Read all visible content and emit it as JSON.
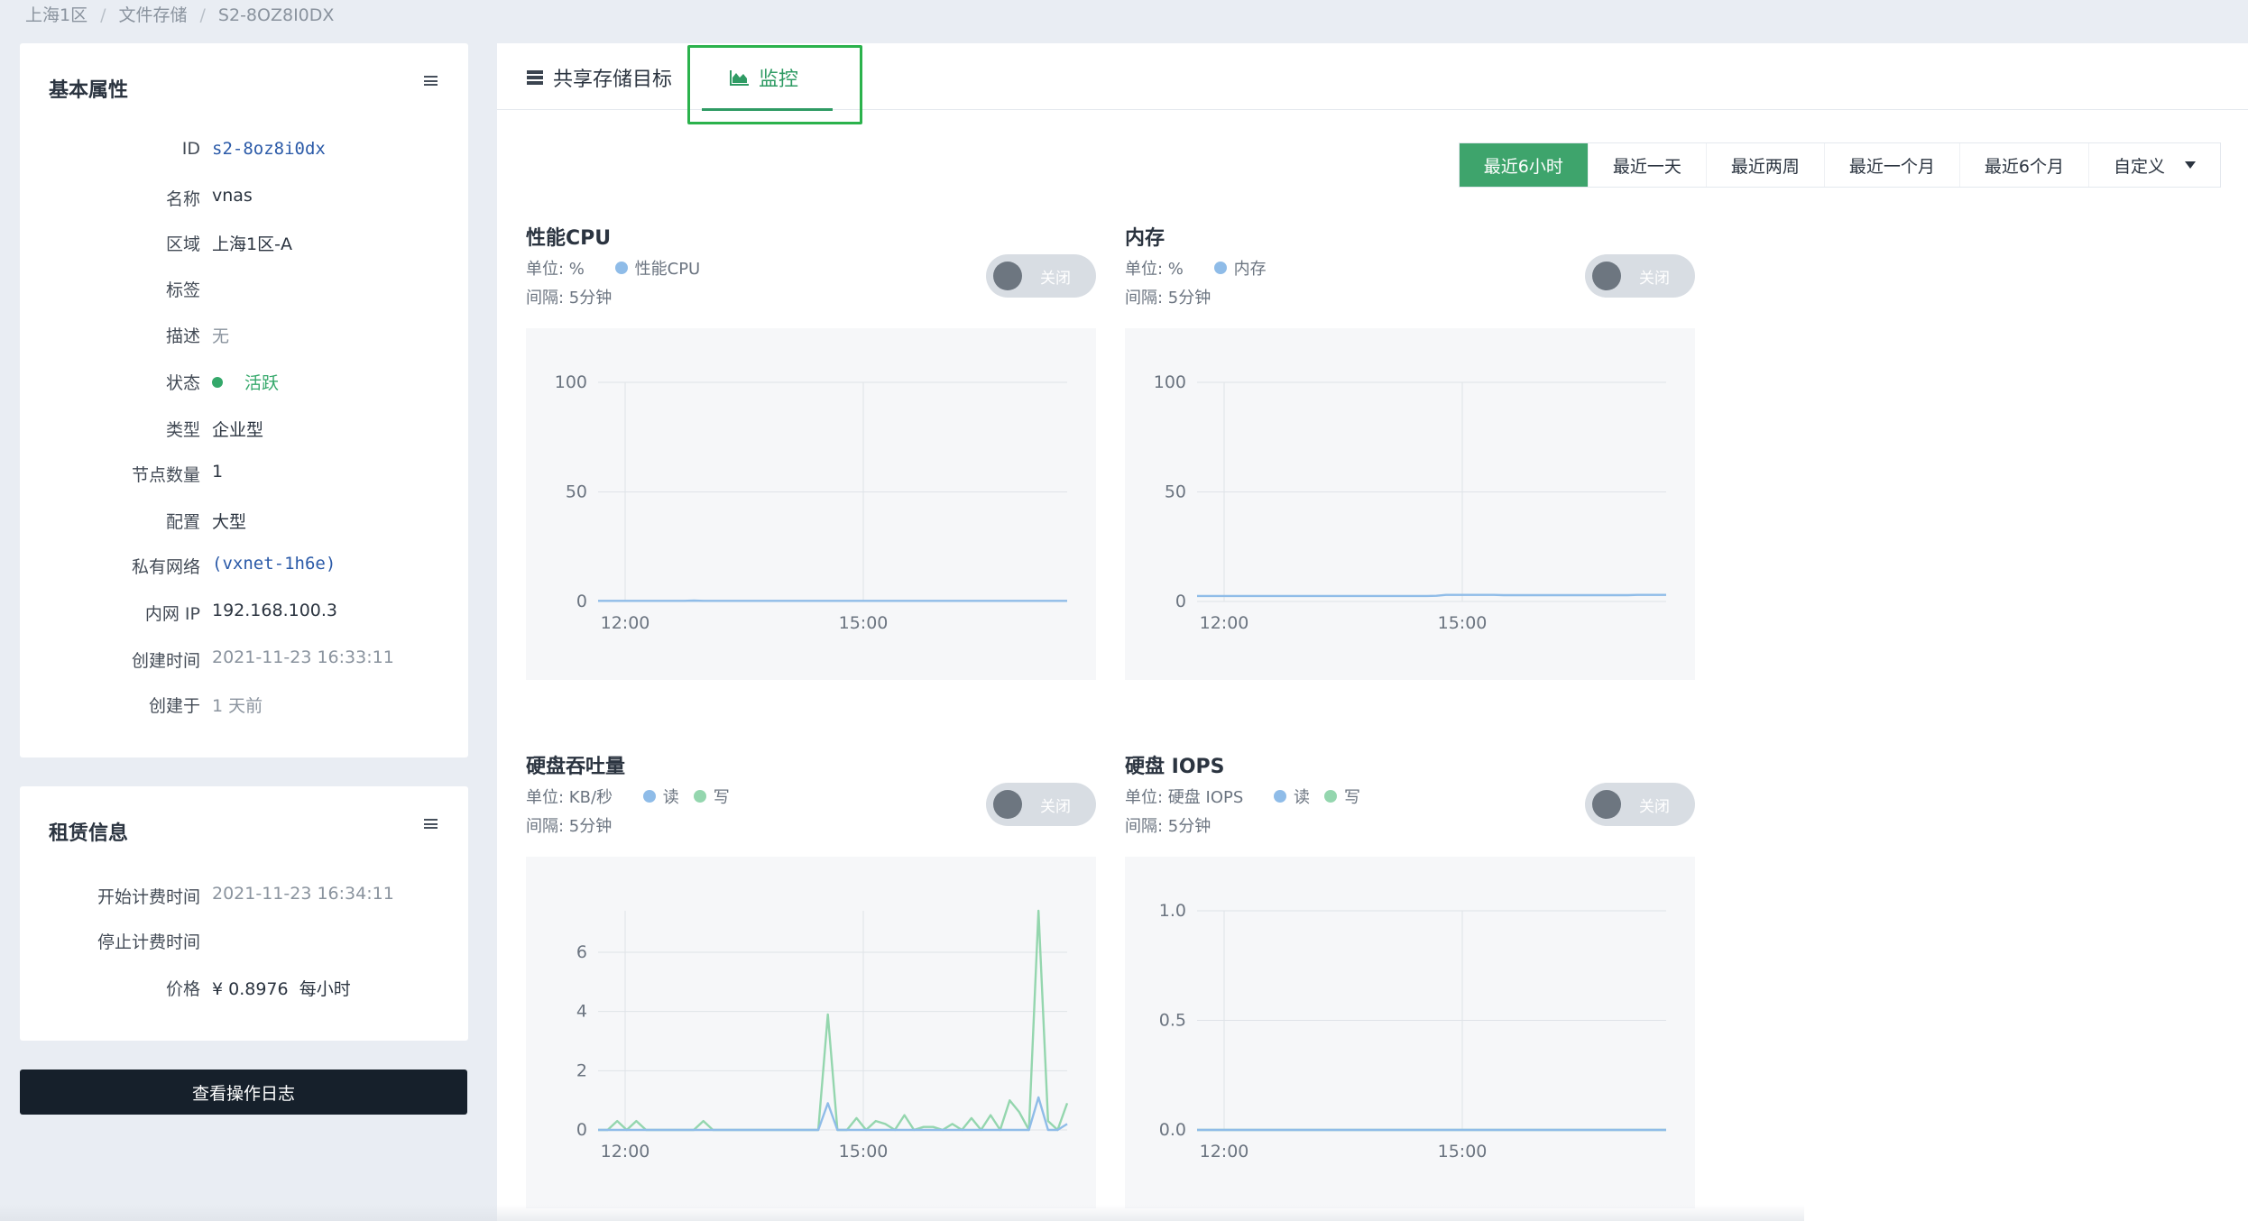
{
  "breadcrumb": [
    "上海1区",
    "文件存储",
    "S2-8OZ8I0DX"
  ],
  "basic_props": {
    "title": "基本属性",
    "rows": [
      {
        "label": "ID",
        "value": "s2-8oz8i0dx"
      },
      {
        "label": "名称",
        "value": "vnas"
      },
      {
        "label": "区域",
        "value": "上海1区-A"
      },
      {
        "label": "标签",
        "value": ""
      },
      {
        "label": "描述",
        "value": "无"
      },
      {
        "label": "状态",
        "value": "活跃"
      },
      {
        "label": "类型",
        "value": "企业型"
      },
      {
        "label": "节点数量",
        "value": "1"
      },
      {
        "label": "配置",
        "value": "大型"
      },
      {
        "label": "私有网络",
        "value": "(vxnet-1h6e)"
      },
      {
        "label": "内网 IP",
        "value": "192.168.100.3"
      },
      {
        "label": "创建时间",
        "value": "2021-11-23 16:33:11"
      },
      {
        "label": "创建于",
        "value": "1 天前"
      }
    ]
  },
  "lease": {
    "title": "租赁信息",
    "rows": [
      {
        "label": "开始计费时间",
        "value": "2021-11-23 16:34:11"
      },
      {
        "label": "停止计费时间",
        "value": ""
      },
      {
        "label": "价格",
        "value": "¥ 0.8976  每小时"
      }
    ]
  },
  "log_button": "查看操作日志",
  "tabs": [
    {
      "label": "共享存储目标",
      "icon": "storage-icon",
      "active": false
    },
    {
      "label": "监控",
      "icon": "area-chart-icon",
      "active": true
    }
  ],
  "time_ranges": [
    "最近6小时",
    "最近一天",
    "最近两周",
    "最近一个月",
    "最近6个月",
    "自定义"
  ],
  "active_range": "最近6小时",
  "colors": {
    "accent": "#3ea46c",
    "read": "#8fbce8",
    "write": "#94d6ae",
    "highlight": "#2bb24c"
  },
  "charts": [
    {
      "title": "性能CPU",
      "unit": "单位: %",
      "interval": "间隔: 5分钟",
      "toggle_label": "关闭",
      "legend": [
        {
          "name": "性能CPU",
          "color": "#8fbce8"
        }
      ],
      "chart_data": {
        "type": "line",
        "ylim": [
          0,
          100
        ],
        "yticks": [
          "0",
          "50",
          "100"
        ],
        "xticks": [
          "12:00",
          "15:00"
        ],
        "series": [
          {
            "name": "性能CPU",
            "color": "#8fbce8",
            "values": [
              0.3,
              0.3,
              0.3,
              0.3,
              0.3,
              0.3,
              0.3,
              0.3,
              0.3,
              0.3,
              0.4,
              0.3,
              0.3,
              0.3,
              0.3,
              0.3,
              0.3,
              0.3,
              0.3,
              0.3,
              0.3,
              0.3,
              0.3,
              0.3,
              0.3,
              0.3,
              0.3,
              0.3,
              0.3,
              0.3,
              0.3,
              0.3,
              0.3,
              0.3,
              0.3,
              0.3,
              0.3,
              0.3,
              0.3,
              0.3,
              0.3,
              0.3,
              0.3,
              0.3,
              0.3,
              0.3,
              0.3,
              0.3,
              0.3,
              0.3
            ]
          }
        ]
      }
    },
    {
      "title": "内存",
      "unit": "单位: %",
      "interval": "间隔: 5分钟",
      "toggle_label": "关闭",
      "legend": [
        {
          "name": "内存",
          "color": "#8fbce8"
        }
      ],
      "chart_data": {
        "type": "line",
        "ylim": [
          0,
          100
        ],
        "yticks": [
          "0",
          "50",
          "100"
        ],
        "xticks": [
          "12:00",
          "15:00"
        ],
        "series": [
          {
            "name": "内存",
            "color": "#8fbce8",
            "values": [
              2.5,
              2.5,
              2.5,
              2.5,
              2.5,
              2.5,
              2.5,
              2.5,
              2.5,
              2.5,
              2.5,
              2.5,
              2.5,
              2.5,
              2.5,
              2.5,
              2.5,
              2.5,
              2.5,
              2.5,
              2.5,
              2.5,
              2.5,
              2.5,
              2.5,
              2.6,
              3,
              3,
              3,
              3,
              3,
              3,
              2.9,
              2.9,
              2.9,
              2.9,
              2.9,
              2.9,
              2.9,
              2.9,
              2.9,
              2.9,
              2.9,
              2.9,
              2.9,
              2.9,
              3,
              3,
              3,
              3
            ]
          }
        ]
      }
    },
    {
      "title": "硬盘吞吐量",
      "unit": "单位: KB/秒",
      "interval": "间隔: 5分钟",
      "toggle_label": "关闭",
      "legend": [
        {
          "name": "读",
          "color": "#8fbce8"
        },
        {
          "name": "写",
          "color": "#94d6ae"
        }
      ],
      "chart_data": {
        "type": "line",
        "ylim": [
          0,
          7.4
        ],
        "yticks": [
          "0",
          "2",
          "4",
          "6"
        ],
        "ytick_values": [
          0,
          2,
          4,
          6
        ],
        "xticks": [
          "12:00",
          "15:00"
        ],
        "series": [
          {
            "name": "读",
            "color": "#8fbce8",
            "values": [
              0,
              0,
              0,
              0,
              0,
              0,
              0,
              0,
              0,
              0,
              0,
              0,
              0,
              0,
              0,
              0,
              0,
              0,
              0,
              0,
              0,
              0,
              0,
              0,
              0.9,
              0,
              0,
              0,
              0,
              0,
              0,
              0,
              0,
              0,
              0,
              0,
              0,
              0,
              0,
              0,
              0,
              0,
              0,
              0,
              0,
              0,
              1.1,
              0,
              0,
              0.2
            ]
          },
          {
            "name": "写",
            "color": "#94d6ae",
            "values": [
              0,
              0,
              0.3,
              0,
              0.3,
              0,
              0,
              0,
              0,
              0,
              0,
              0.3,
              0,
              0,
              0,
              0,
              0,
              0,
              0,
              0,
              0,
              0,
              0,
              0,
              3.9,
              0,
              0,
              0.4,
              0,
              0.3,
              0.2,
              0,
              0.5,
              0,
              0.1,
              0.1,
              0,
              0.2,
              0,
              0.4,
              0,
              0.5,
              0,
              1,
              0.6,
              0,
              7.4,
              0.3,
              0,
              0.9
            ]
          }
        ]
      }
    },
    {
      "title": "硬盘 IOPS",
      "unit": "单位: 硬盘 IOPS",
      "interval": "间隔: 5分钟",
      "toggle_label": "关闭",
      "legend": [
        {
          "name": "读",
          "color": "#8fbce8"
        },
        {
          "name": "写",
          "color": "#94d6ae"
        }
      ],
      "chart_data": {
        "type": "line",
        "ylim": [
          0,
          1.0
        ],
        "yticks": [
          "0.0",
          "0.5",
          "1.0"
        ],
        "ytick_values": [
          0,
          0.5,
          1.0
        ],
        "xticks": [
          "12:00",
          "15:00"
        ],
        "series": [
          {
            "name": "读",
            "color": "#8fbce8",
            "values": [
              0,
              0,
              0,
              0,
              0,
              0,
              0,
              0,
              0,
              0,
              0,
              0,
              0,
              0,
              0,
              0,
              0,
              0,
              0,
              0,
              0,
              0,
              0,
              0,
              0,
              0,
              0,
              0,
              0,
              0,
              0,
              0,
              0,
              0,
              0,
              0,
              0,
              0,
              0,
              0,
              0,
              0,
              0,
              0,
              0,
              0,
              0,
              0,
              0,
              0
            ]
          },
          {
            "name": "写",
            "color": "#94d6ae",
            "values": [
              0,
              0,
              0,
              0,
              0,
              0,
              0,
              0,
              0,
              0,
              0,
              0,
              0,
              0,
              0,
              0,
              0,
              0,
              0,
              0,
              0,
              0,
              0,
              0,
              0,
              0,
              0,
              0,
              0,
              0,
              0,
              0,
              0,
              0,
              0,
              0,
              0,
              0,
              0,
              0,
              0,
              0,
              0,
              0,
              0,
              0,
              0,
              0,
              0,
              0
            ]
          }
        ]
      }
    }
  ]
}
